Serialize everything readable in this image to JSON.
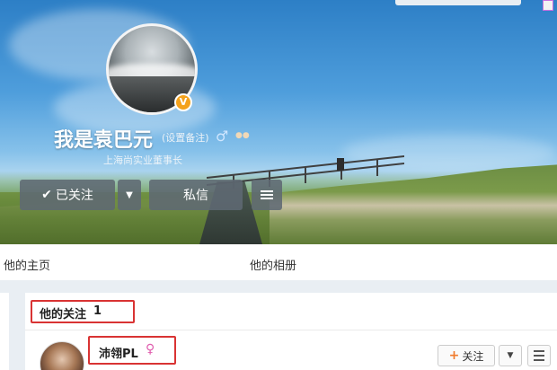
{
  "profile": {
    "name": "我是袁巴元",
    "remark_link": "(设置备注)",
    "subtitle": "上海尚实业董事长",
    "verified_badge": "V"
  },
  "actions": {
    "follow_label": "已关注",
    "message_label": "私信"
  },
  "tabs": [
    {
      "label": "他的主页"
    },
    {
      "label": "他的相册"
    }
  ],
  "following": {
    "title": "他的关注",
    "count": "1",
    "users": [
      {
        "name": "沛翎PL",
        "follow_label": "关注"
      }
    ]
  },
  "icons": {
    "gender": "male-icon",
    "user_gender": "female-icon",
    "check": "check-icon",
    "dropdown": "chevron-down-icon",
    "menu": "menu-icon",
    "add": "plus-icon"
  },
  "colors": {
    "highlight_border": "#d93333",
    "verified": "#f4a21c",
    "add_plus": "#f07a2b"
  }
}
